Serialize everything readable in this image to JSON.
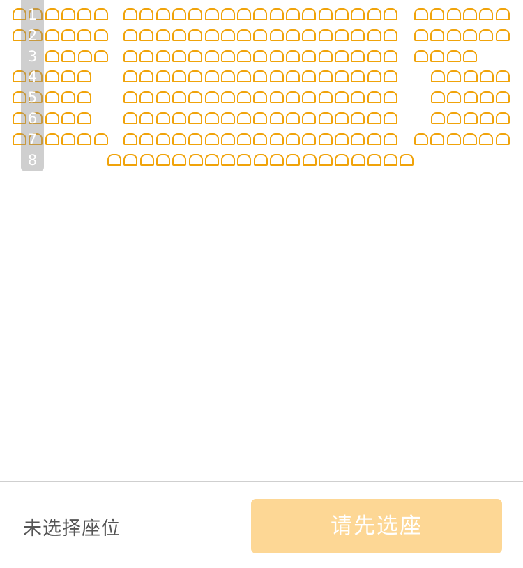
{
  "seat_map": {
    "rows": [
      {
        "label": "1",
        "seats": [
          6,
          17,
          6
        ]
      },
      {
        "label": "2",
        "seats": [
          6,
          17,
          6
        ]
      },
      {
        "label": "3",
        "seats": [
          4,
          17,
          4
        ]
      },
      {
        "label": "4",
        "seats": [
          5,
          17,
          5
        ]
      },
      {
        "label": "5",
        "seats": [
          5,
          17,
          5
        ]
      },
      {
        "label": "6",
        "seats": [
          5,
          17,
          5
        ]
      },
      {
        "label": "7",
        "seats": [
          6,
          17,
          6
        ]
      },
      {
        "label": "8",
        "seats": [
          19
        ]
      }
    ],
    "seat_color": "#f0a30a"
  },
  "footer": {
    "status_text": "未选择座位",
    "confirm_label": "请先选座",
    "confirm_color": "#fdd795"
  }
}
